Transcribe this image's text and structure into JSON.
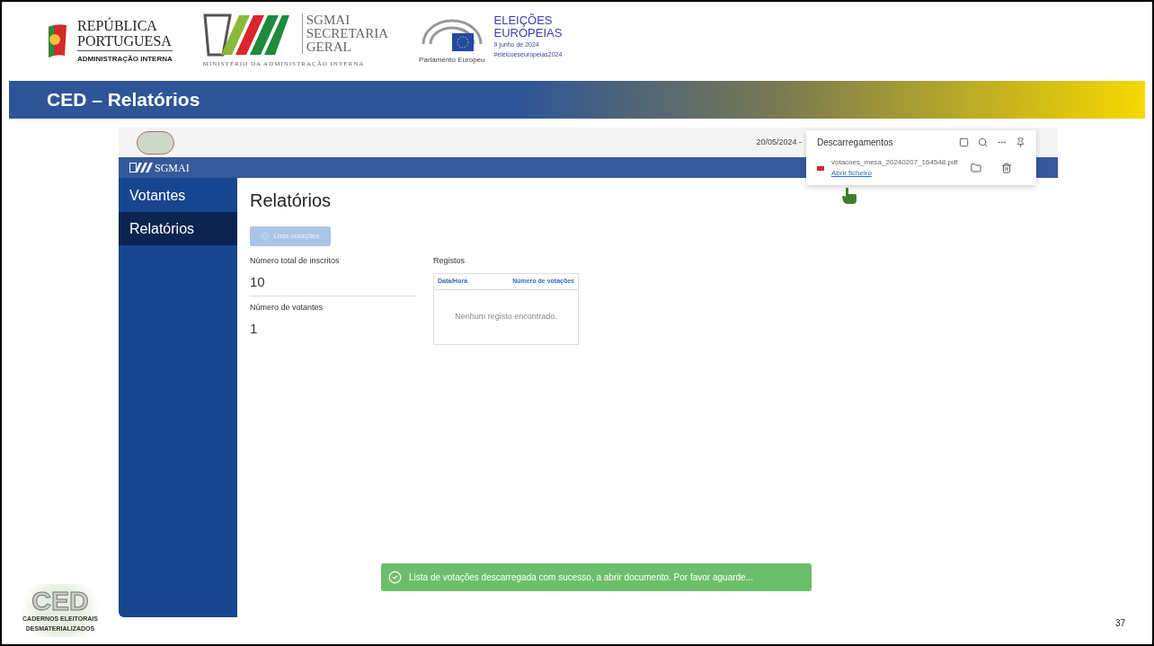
{
  "header": {
    "republica": {
      "line1": "REPÚBLICA",
      "line2": "PORTUGUESA",
      "subtitle": "ADMINISTRAÇÃO INTERNA"
    },
    "sgmai": {
      "line1": "SGMAI",
      "line2": "SECRETARIA",
      "line3": "GERAL",
      "subtitle": "MINISTÉRIO DA ADMINISTRAÇÃO INTERNA"
    },
    "parlamento": {
      "caption": "Parlamento Europeu"
    },
    "eleicoes": {
      "line1": "ELEIÇÕES",
      "line2": "EUROPEIAS",
      "date": "9 junho de 2024",
      "hashtag": "#eleicoeseuropeias2024"
    }
  },
  "slide_title": "CED – Relatórios",
  "app": {
    "top_bar": {
      "date": "20/05/2024 -"
    },
    "brand": "SGMAI",
    "sidebar": [
      {
        "label": "Votantes",
        "selected": false
      },
      {
        "label": "Relatórios",
        "selected": true
      }
    ],
    "page_title": "Relatórios",
    "action_button": {
      "label": "Lista votações",
      "disabled": true
    },
    "stats": [
      {
        "label": "Número total de inscritos",
        "value": "10"
      },
      {
        "label": "Número de votantes",
        "value": "1"
      }
    ],
    "records": {
      "title": "Registos",
      "columns": [
        "Data/Hora",
        "Número de votações"
      ],
      "empty_text": "Nenhum registo encontrado."
    },
    "downloads": {
      "title": "Descarregamentos",
      "file": "votacoes_mesa_20240207_164548.pdf",
      "link": "Abrir ficheiro"
    },
    "toast": {
      "text": "Lista de votações descarregada com sucesso, a abrir documento. Por favor aguarde..."
    }
  },
  "footer_logo": {
    "letters": "CED",
    "line1": "CADERNOS ELEITORAIS",
    "line2": "DESMATERIALIZADOS"
  },
  "page_number": "37"
}
